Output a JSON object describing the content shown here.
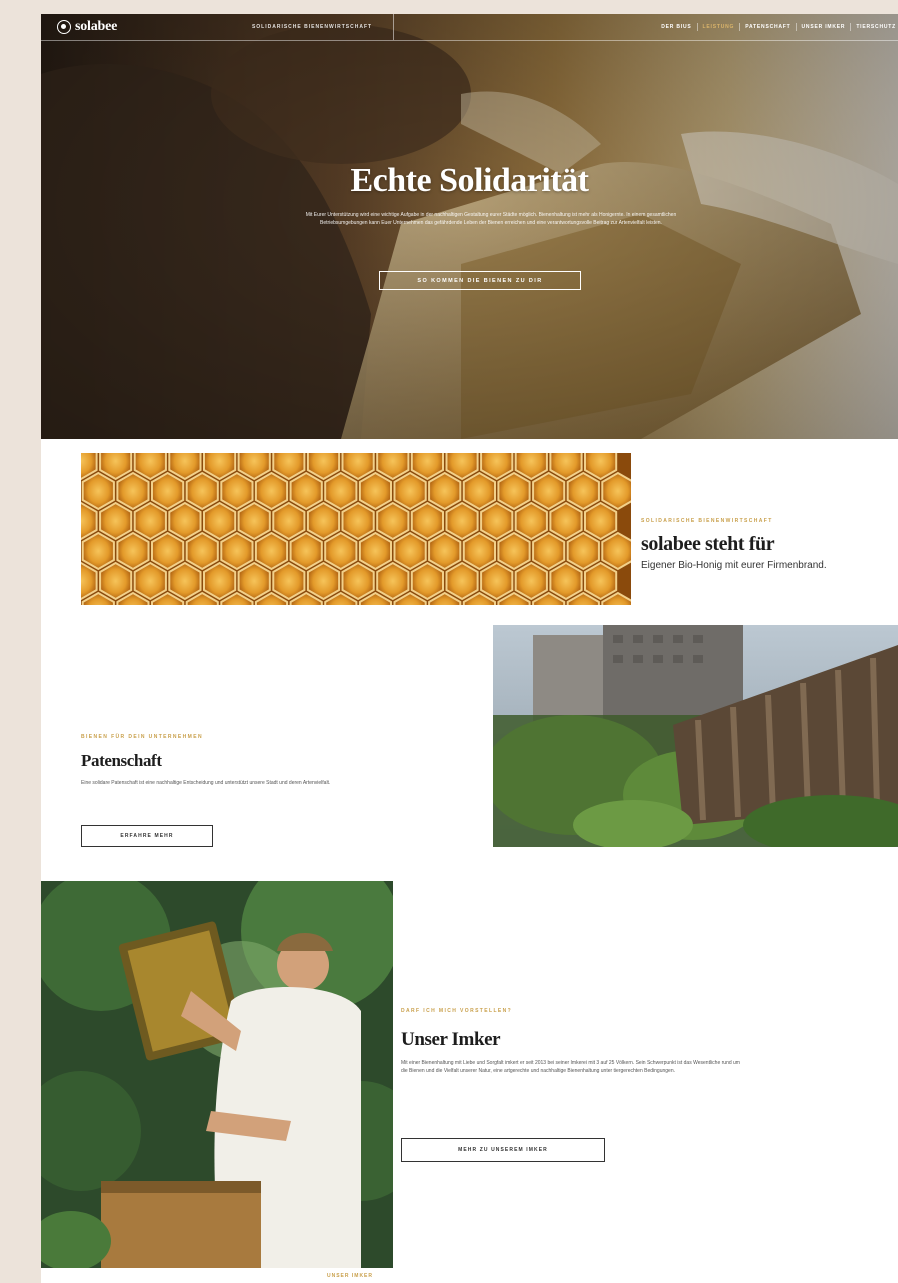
{
  "nav": {
    "logo": "solabee",
    "tagline": "Solidarische Bienenwirtschaft",
    "links": [
      "Der Bius",
      "Leistung",
      "Patenschaft",
      "Unser Imker",
      "Tierschutz"
    ]
  },
  "hero": {
    "title": "Echte Solidarität",
    "text": "Mit Eurer Unterstützung wird eine wichtige Aufgabe in der nachhaltigen Gestaltung eurer Städte möglich. Bienenhaltung ist mehr als Honigernte. In einem gesamtlichen Betriebsumgebungen kann Euer Unternehmen das gefährdende Leben der Bienen erreichen und eine verantwortungsvolle Beitrag zur Artenvielfalt leisten.",
    "cta": "So kommen die Bienen zu Dir"
  },
  "section1": {
    "eyebrow": "Solidarische Bienenwirtschaft",
    "title": "solabee steht für",
    "subtitle": "Eigener Bio-Honig mit eurer Firmenbrand."
  },
  "section2": {
    "eyebrow": "Bienen für Dein Unternehmen",
    "title": "Patenschaft",
    "body": "Eine solidare Patenschaft ist eine nachhaltige Entscheidung und unterstützt unsere Stadt und deren Artenvielfalt.",
    "button": "Erfahre mehr"
  },
  "section3": {
    "eyebrow": "Darf ich mich vorstellen?",
    "title": "Unser Imker",
    "body": "Mit einer Bienenhaltung mit Liebe und Sorgfalt imkert er seit 2013 bei seiner Imkerei mit 3 auf 25 Völkern. Sein Schwerpunkt ist das Wesentliche rund um die Bienen und die Vielfalt unserer Natur, eine artgerechte und nachhaltige Bienenhaltung unter tiergerechten Bedingungen.",
    "button": "Mehr zu unserem Imker",
    "caption": "Unser Imker"
  },
  "colors": {
    "accent": "#c9a04c",
    "nav_active": "#d9b36a"
  }
}
